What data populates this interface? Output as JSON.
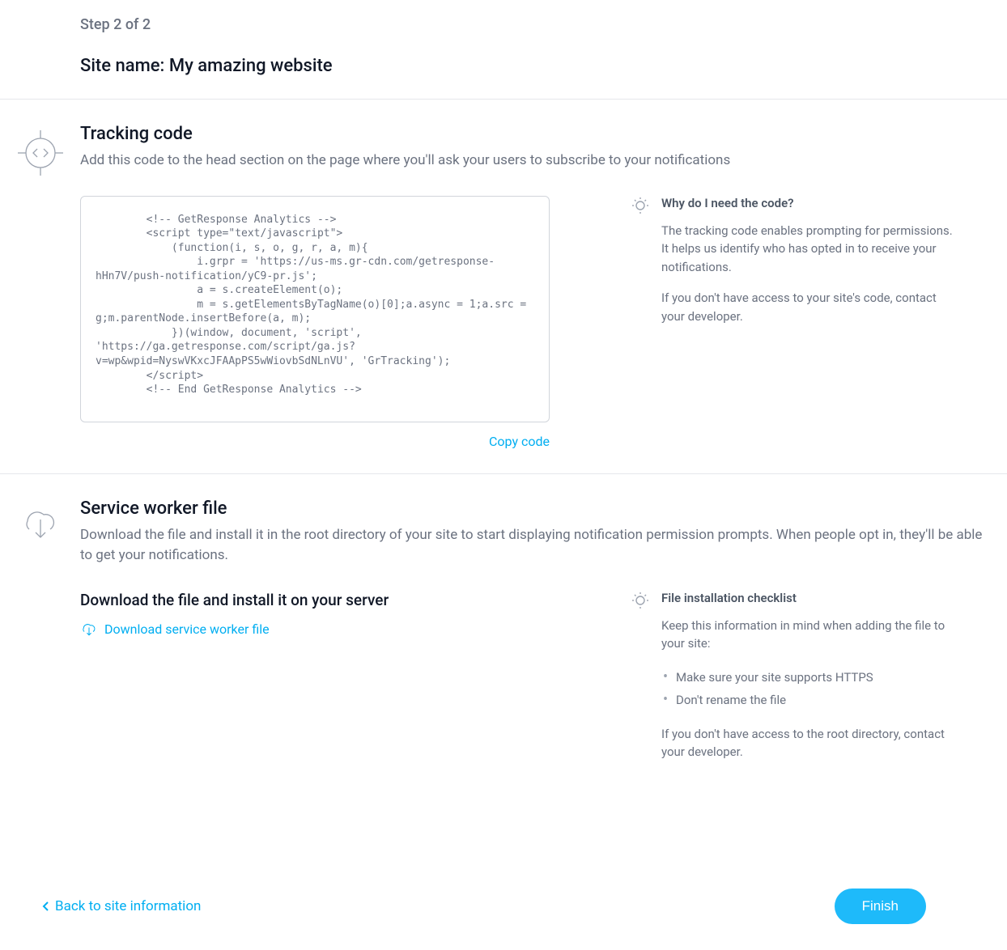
{
  "header": {
    "step_label": "Step 2 of 2",
    "site_name": "Site name: My amazing website"
  },
  "tracking": {
    "title": "Tracking code",
    "description": "Add this code to the head section on the page where you'll ask your users to subscribe to your notifications",
    "code": "        <!-- GetResponse Analytics -->\n        <script type=\"text/javascript\">\n            (function(i, s, o, g, r, a, m){\n                i.grpr = 'https://us-ms.gr-cdn.com/getresponse-hHn7V/push-notification/yC9-pr.js';\n                a = s.createElement(o);\n                m = s.getElementsByTagName(o)[0];a.async = 1;a.src = g;m.parentNode.insertBefore(a, m);\n            })(window, document, 'script', 'https://ga.getresponse.com/script/ga.js?v=wp&wpid=NyswVKxcJFAApPS5wWiovbSdNLnVU', 'GrTracking');\n        </script>\n        <!-- End GetResponse Analytics -->",
    "copy_label": "Copy code",
    "tip": {
      "title": "Why do I need the code?",
      "p1": "The tracking code enables prompting for permissions. It helps us identify who has opted in to receive your notifications.",
      "p2": "If you don't have access to your site's code, contact your developer."
    }
  },
  "worker": {
    "title": "Service worker file",
    "description": "Download the file and install it in the root directory of your site to start displaying notification permission prompts. When people opt in, they'll be able to get your notifications.",
    "subheading": "Download the file and install it on your server",
    "download_label": "Download service worker file",
    "tip": {
      "title": "File installation checklist",
      "p1": "Keep this information in mind when adding the file to your site:",
      "items": [
        "Make sure your site supports HTTPS",
        "Don't rename the file"
      ],
      "p2": "If you don't have access to the root directory, contact your developer."
    }
  },
  "footer": {
    "back_label": "Back to site information",
    "finish_label": "Finish"
  }
}
